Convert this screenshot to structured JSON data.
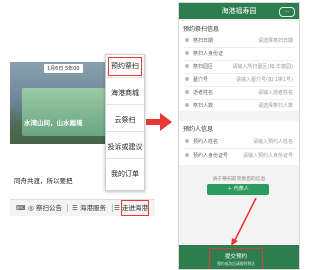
{
  "left_screen": {
    "date_badge": "1月6日 5年00",
    "photo_caption": "水湾山间，山水画境",
    "body_text": "同舟共渡，所以要把",
    "dots_label": "···",
    "menu_items": [
      {
        "label": "预约祭扫"
      },
      {
        "label": "海港商城"
      },
      {
        "label": "云祭扫"
      },
      {
        "label": "投诉或建议"
      },
      {
        "label": "我的订单"
      }
    ],
    "nav": {
      "announce": "祭扫公告",
      "service": "海港服务",
      "enter": "走进海港"
    }
  },
  "right_screen": {
    "header_title": "海港福寿园",
    "header_icon": "···",
    "section1_title": "预约祭扫信息",
    "section1_rows": [
      {
        "label": "祭扫日期",
        "value": "请选择祭扫日期"
      },
      {
        "label": "祭扫人身份证",
        "value": ""
      },
      {
        "label": "祭扫园区",
        "value": "请输入所扫墓区(如:华富园)"
      },
      {
        "label": "墓穴号",
        "value": "请输入墓穴号(如:1排1号)"
      },
      {
        "label": "逝者姓名",
        "value": "请输入逝者姓名"
      },
      {
        "label": "祭扫人数",
        "value": "请选择祭扫人数"
      }
    ],
    "section2_title": "预约人信息",
    "section2_rows": [
      {
        "label": "预约人姓名",
        "value": "请输入预约人姓名"
      },
      {
        "label": "预约人身份证号",
        "value": "请输入预约人身份证号"
      }
    ],
    "hint": "请于祭扫前完善您的信息",
    "add_button": "＋ 代祭人",
    "submit_label": "提交预约",
    "submit_sub": "预约成功后请按时到达"
  },
  "colors": {
    "primary_green": "#2e7d4f",
    "highlight_red": "#e53935"
  }
}
